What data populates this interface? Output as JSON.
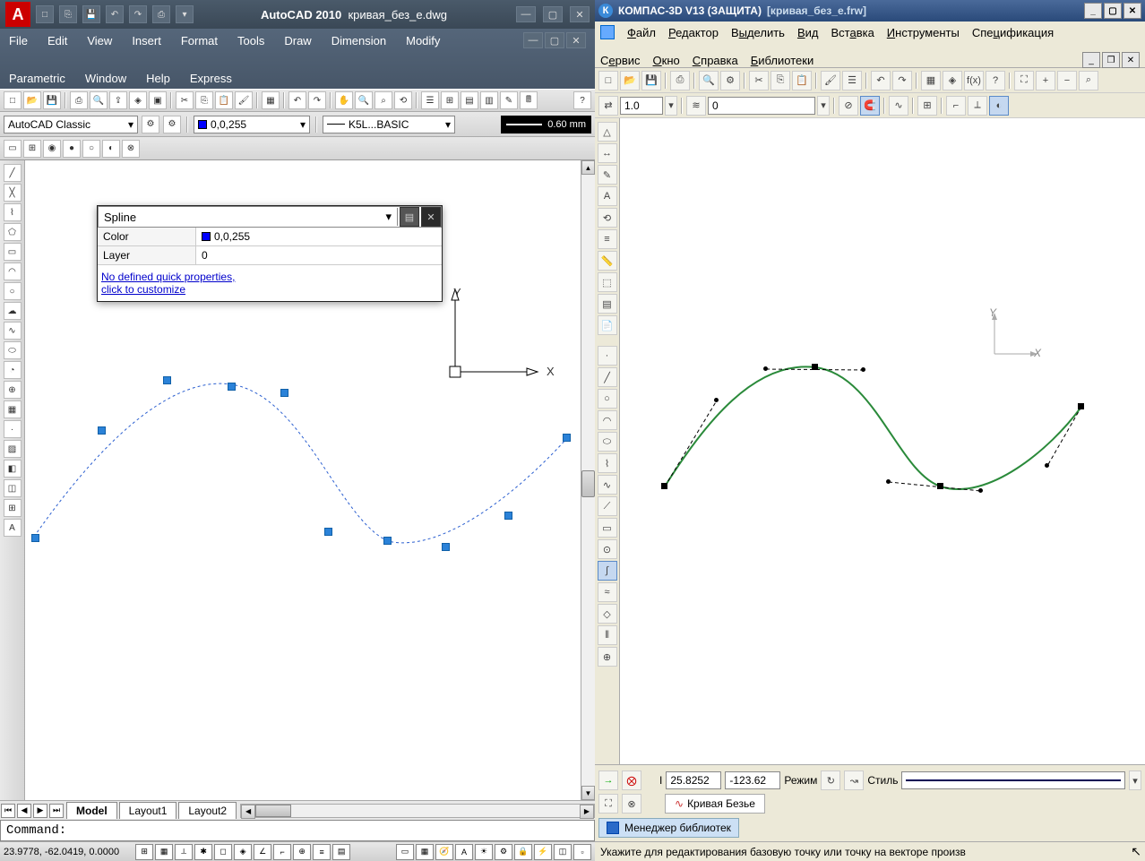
{
  "autocad": {
    "app_name": "AutoCAD 2010",
    "doc_name": "кривая_без_е.dwg",
    "menus_row1": [
      "File",
      "Edit",
      "View",
      "Insert",
      "Format",
      "Tools",
      "Draw",
      "Dimension",
      "Modify"
    ],
    "menus_row2": [
      "Parametric",
      "Window",
      "Help",
      "Express"
    ],
    "workspace": "AutoCAD Classic",
    "color_combo": "0,0,255",
    "linetype_combo": "K5L...BASIC",
    "lineweight_readout": "0.60 mm",
    "quick_props": {
      "type": "Spline",
      "rows": [
        {
          "label": "Color",
          "value": "0,0,255",
          "swatch": true
        },
        {
          "label": "Layer",
          "value": "0",
          "swatch": false
        }
      ],
      "link1": "No defined quick properties,",
      "link2": "click to customize"
    },
    "axis_y": "Y",
    "axis_x": "X",
    "tabs": [
      "Model",
      "Layout1",
      "Layout2"
    ],
    "cmd_prompt": "Command:",
    "status_coords": "23.9778, -62.0419, 0.0000"
  },
  "kompas": {
    "app_title": "КОМПАС-3D V13 (ЗАЩИТА)",
    "doc_title": "[кривая_без_е.frw]",
    "menus_row1": [
      "Файл",
      "Редактор",
      "Выделить",
      "Вид",
      "Вставка",
      "Инструменты",
      "Спецификация"
    ],
    "menus_row2": [
      "Сервис",
      "Окно",
      "Справка",
      "Библиотеки"
    ],
    "scale_input": "1.0",
    "state_input": "0",
    "axis_y": "Y",
    "axis_x": "X",
    "prop_coord_x": "25.8252",
    "prop_coord_y": "-123.62",
    "prop_mode_label": "Режим",
    "prop_style_label": "Стиль",
    "tab_label": "Кривая Безье",
    "libs_label": "Менеджер библиотек",
    "status_text": "Укажите для редактирования базовую точку или точку на векторе произв"
  }
}
